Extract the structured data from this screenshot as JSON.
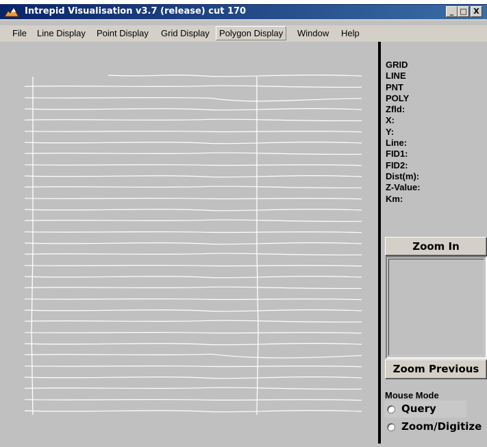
{
  "window": {
    "title": "Intrepid Visualisation v3.7 (release) cut 170",
    "controls": {
      "minimize": "_",
      "maximize": "□",
      "close": "X"
    }
  },
  "menu": {
    "items": [
      "File",
      "Line Display",
      "Point Display",
      "Grid Display",
      "Polygon Display",
      "Window",
      "Help"
    ],
    "active": "Polygon Display"
  },
  "info_panel": {
    "labels": [
      "GRID",
      "LINE",
      "PNT",
      "POLY",
      "Zfld:",
      "X:",
      "Y:",
      "Line:",
      "FID1:",
      "FID2:",
      "Dist(m):",
      "Z-Value:",
      "Km:"
    ]
  },
  "buttons": {
    "zoom_in": "Zoom In",
    "zoom_previous": "Zoom Previous"
  },
  "mouse_mode": {
    "label": "Mouse Mode",
    "options": [
      "Query",
      "Zoom/Digitize"
    ]
  },
  "colors": {
    "title_bar": "#0a246a",
    "canvas_background": "#c0c0c0",
    "survey_lines": "#ffffff"
  },
  "plot": {
    "survey_line_count": 31,
    "tie_line_count": 2
  }
}
